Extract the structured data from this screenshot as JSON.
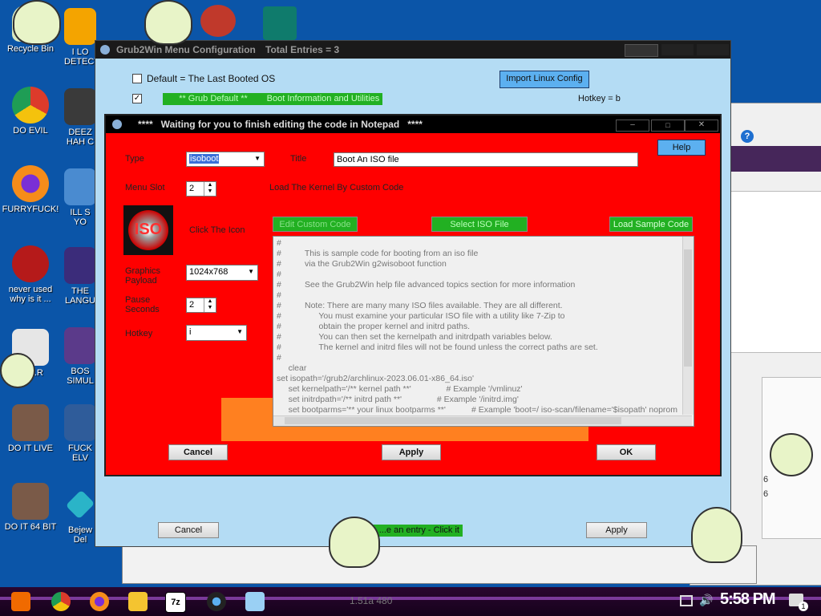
{
  "desktop": {
    "icons": [
      {
        "label": "Recycle Bin",
        "color": "#d8e8c0"
      },
      {
        "label": "DO EVIL",
        "color": "#dc3b2b"
      },
      {
        "label": "FURRYFUCK!",
        "color": "#e05b14"
      },
      {
        "label": "never used why is it ...",
        "color": "#b51a1a"
      },
      {
        "label": "SA...R",
        "color": "#e6e6e6"
      },
      {
        "label": "DO IT LIVE",
        "color": "#7a5a48"
      },
      {
        "label": "DO IT 64 BIT",
        "color": "#7a5a48"
      },
      {
        "label": "I LO DETECT",
        "color": "#f4a400"
      },
      {
        "label": "DEEZ HAH C",
        "color": "#3a3a3a"
      },
      {
        "label": "ILL S YO",
        "color": "#4a8bd0"
      },
      {
        "label": "THE LANGU",
        "color": "#3b2c7a"
      },
      {
        "label": "BOS SIMUL",
        "color": "#5b3a8a"
      },
      {
        "label": "FUCK ELV",
        "color": "#2f5c9a"
      },
      {
        "label": "Bejew Del",
        "color": "#2ab4c8"
      }
    ]
  },
  "menu_window": {
    "title": "Grub2Win Menu Configuration",
    "total_entries": "Total Entries = 3",
    "default_checkbox_label": "Default = The Last Booted OS",
    "import_button": "Import Linux Config",
    "entry_default": "** Grub Default **",
    "entry_name": "Boot Information and Utilities",
    "entry_hotkey": "Hotkey = b",
    "cancel_button": "Cancel",
    "apply_button": "Apply",
    "manage_hint": "...e an entry - Click it"
  },
  "editor_window": {
    "title": "****   Waiting for you to finish editing the code in Notepad   ****",
    "help_button": "Help",
    "type_label": "Type",
    "type_value": "isoboot",
    "title_label": "Title",
    "title_value": "Boot An ISO file",
    "menu_slot_label": "Menu Slot",
    "menu_slot_value": "2",
    "load_kernel_label": "Load The Kernel By   Custom Code",
    "click_icon_label": "Click The Icon",
    "iso_icon_text": "ISO",
    "edit_code_button": "Edit Custom Code",
    "select_iso_button": "Select ISO File",
    "load_sample_button": "Load Sample Code",
    "graphics_label": "Graphics Payload",
    "graphics_value": "1024x768",
    "pause_label": "Pause Seconds",
    "pause_value": "2",
    "hotkey_label": "Hotkey",
    "hotkey_value": "i",
    "code_lines": [
      "#",
      "#          This is sample code for booting from an iso file",
      "#          via the Grub2Win g2wisoboot function",
      "#",
      "#          See the Grub2Win help file advanced topics section for more information",
      "#",
      "#          Note: There are many many ISO files available. They are all different.",
      "#                You must examine your particular ISO file with a utility like 7-Zip to",
      "#                obtain the proper kernel and initrd paths.",
      "#                You can then set the kernelpath and initrdpath variables below.",
      "#                The kernel and initrd files will not be found unless the correct paths are set.",
      "#",
      "     clear",
      "set isopath='/grub2/archlinux-2023.06.01-x86_64.iso'",
      "     set kernelpath='/** kernel path **'               # Example '/vmlinuz'",
      "     set initrdpath='/** initrd path **'               # Example '/initrd.img'",
      "     set bootparms='** your linux bootparms **'           # Example 'boot=/ iso-scan/filename='$isopath' noprom"
    ],
    "cancel_button": "Cancel",
    "apply_button": "Apply",
    "ok_button": "OK"
  },
  "taskbar": {
    "time": "5:58 PM",
    "items": [
      "start",
      "chrome",
      "firefox",
      "explorer",
      "7zip",
      "grub2win",
      "notepad"
    ],
    "partial_text": "1.51a 480",
    "notification_count": "1"
  },
  "background_panel": {
    "values": [
      "6",
      "6"
    ]
  },
  "colors": {
    "desktop": "#0b55a8",
    "editor_bg": "#ff0000",
    "menu_bg": "#b4dcf4",
    "green": "#22b022",
    "orange": "#ff8020"
  }
}
